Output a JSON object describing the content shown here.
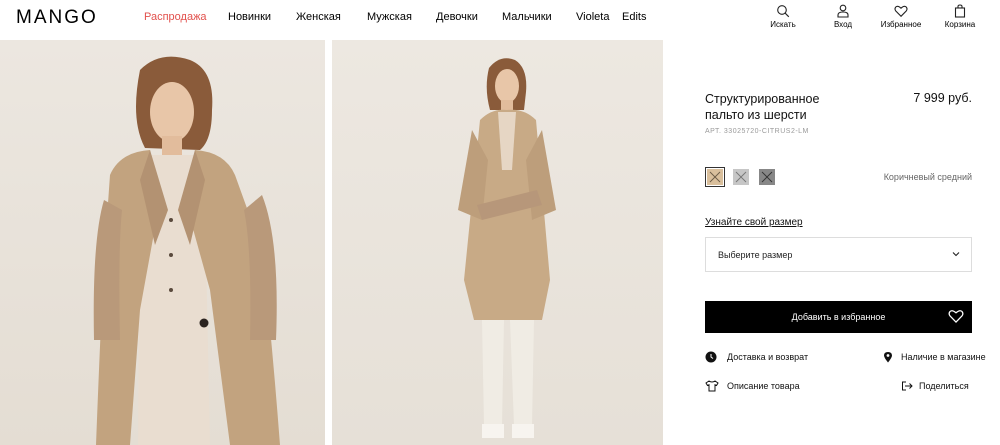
{
  "header": {
    "logo": "MANGO",
    "nav": [
      {
        "label": "Распродажа",
        "accent": "#e2504c"
      },
      {
        "label": "Новинки"
      },
      {
        "label": "Женская"
      },
      {
        "label": "Мужская"
      },
      {
        "label": "Девочки"
      },
      {
        "label": "Мальчики"
      },
      {
        "label": "Violeta"
      },
      {
        "label": "Edits"
      }
    ],
    "tools": {
      "search": "Искать",
      "login": "Вход",
      "favorites": "Избранное",
      "cart": "Корзина"
    }
  },
  "product": {
    "title": "Структурированное пальто из шерсти",
    "price": "7 999 руб.",
    "sku": "АРТ. 33025720-CITRUS2-LM",
    "swatches": [
      {
        "color": "#d9bf9c",
        "selected": true
      },
      {
        "color": "#c6c6c6"
      },
      {
        "color": "#878787"
      }
    ],
    "color_name": "Коричневый средний",
    "size_link": "Узнайте свой размер",
    "size_select": "Выберите размер",
    "add_button": "Добавить в избранное",
    "delivery": "Доставка и возврат",
    "store": "Наличие в магазине",
    "description": "Описание товара",
    "share": "Поделиться"
  },
  "icons": {
    "search": "search-icon",
    "login": "user-icon",
    "favorites": "heart-icon",
    "cart": "bag-icon",
    "delivery": "clock-icon",
    "store": "location-pin-icon",
    "description": "tshirt-icon",
    "share": "share-icon"
  }
}
